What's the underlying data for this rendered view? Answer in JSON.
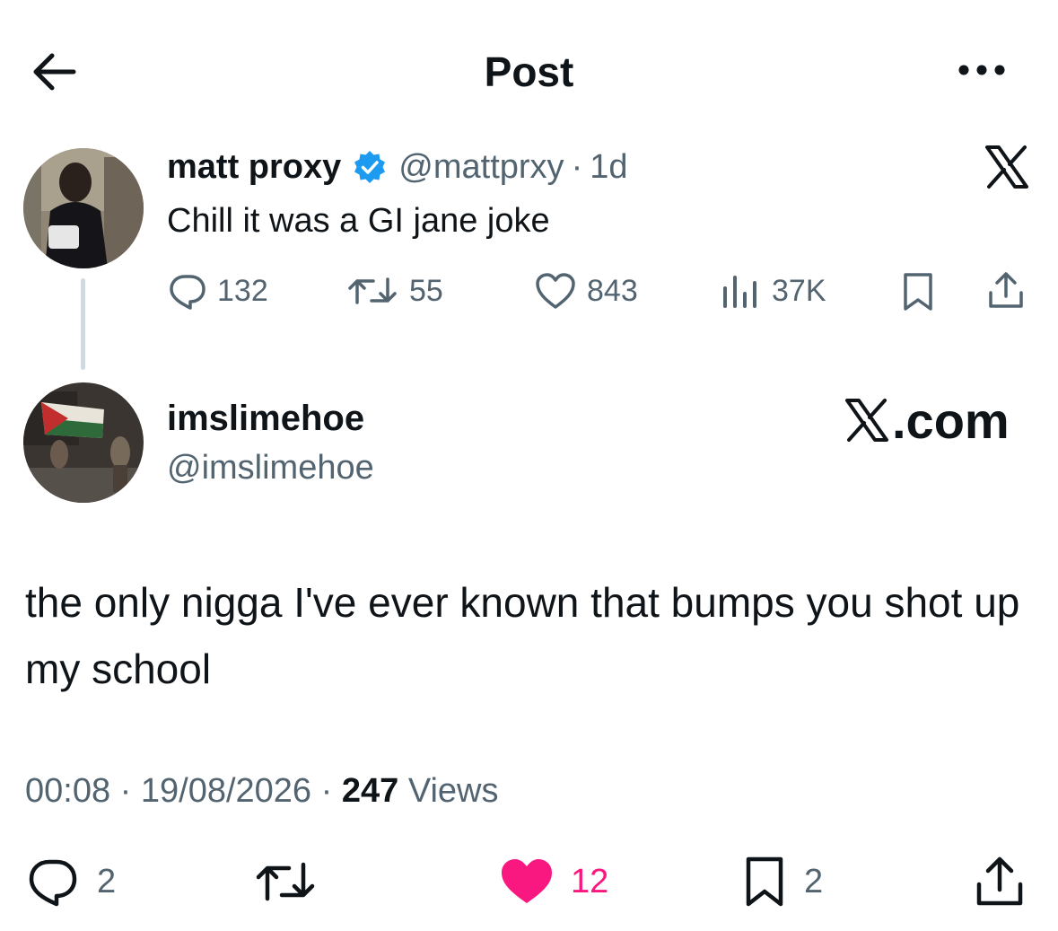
{
  "header": {
    "title": "Post",
    "back_icon": "arrow-left-icon",
    "more_icon": "more-horizontal-icon"
  },
  "parent_post": {
    "display_name": "matt proxy",
    "handle": "@mattprxy",
    "separator": "·",
    "time": "1d",
    "text": "Chill it was a GI jane joke",
    "replies": "132",
    "reposts": "55",
    "likes": "843",
    "views": "37K"
  },
  "main_post": {
    "display_name": "imslimehoe",
    "handle": "@imslimehoe",
    "brand": ".com",
    "text": "the only nigga I've ever known that bumps you shot up my school",
    "time": "00:08",
    "sep1": "·",
    "date": "19/08/2026",
    "sep2": "·",
    "views_count": "247",
    "views_label": "Views",
    "replies": "2",
    "likes": "12",
    "bookmarks": "2"
  },
  "colors": {
    "text": "#0f1419",
    "secondary": "#536471",
    "verified": "#1d9bf0",
    "like_active": "#f91880",
    "thread_line": "#cfd9de"
  }
}
